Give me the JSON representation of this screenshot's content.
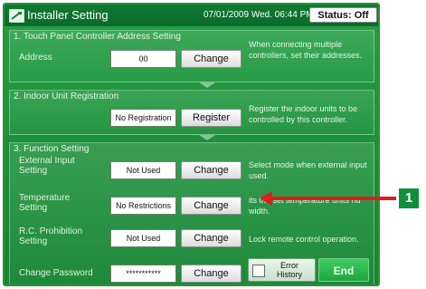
{
  "window": {
    "title": "Installer Setting",
    "datetime": "07/01/2009 Wed. 06:44 PM",
    "status": "Status: Off"
  },
  "sections": {
    "address": {
      "title": "1. Touch Panel Controller Address Setting",
      "label": "Address",
      "value": "00",
      "button": "Change",
      "description": "When connecting multiple controllers, set their addresses."
    },
    "indoor": {
      "title": "2. Indoor Unit Registration",
      "value": "No Registration",
      "button": "Register",
      "description": "Register the indoor units to be controlled by this controller."
    },
    "function": {
      "title": "3. Function Setting",
      "rows": [
        {
          "label": "External Input Setting",
          "value": "Not Used",
          "button": "Change",
          "description": "Select mode when external input used."
        },
        {
          "label": "Temperature Setting",
          "value": "No Restrictions",
          "button": "Change",
          "description": "its the set temperature units nd width."
        },
        {
          "label": "R.C. Prohibition Setting",
          "value": "Not Used",
          "button": "Change",
          "description": "Lock remote control operation."
        },
        {
          "label": "Change Password",
          "value": "***********",
          "button": "Change"
        }
      ]
    }
  },
  "footer": {
    "error_history": "Error History",
    "end": "End"
  },
  "callout": {
    "number": "1"
  },
  "colors": {
    "panel": "#1c8f3a",
    "title_bar": "#0b6a2b",
    "callout": "#e01b1b",
    "end_button": "#20a441"
  }
}
